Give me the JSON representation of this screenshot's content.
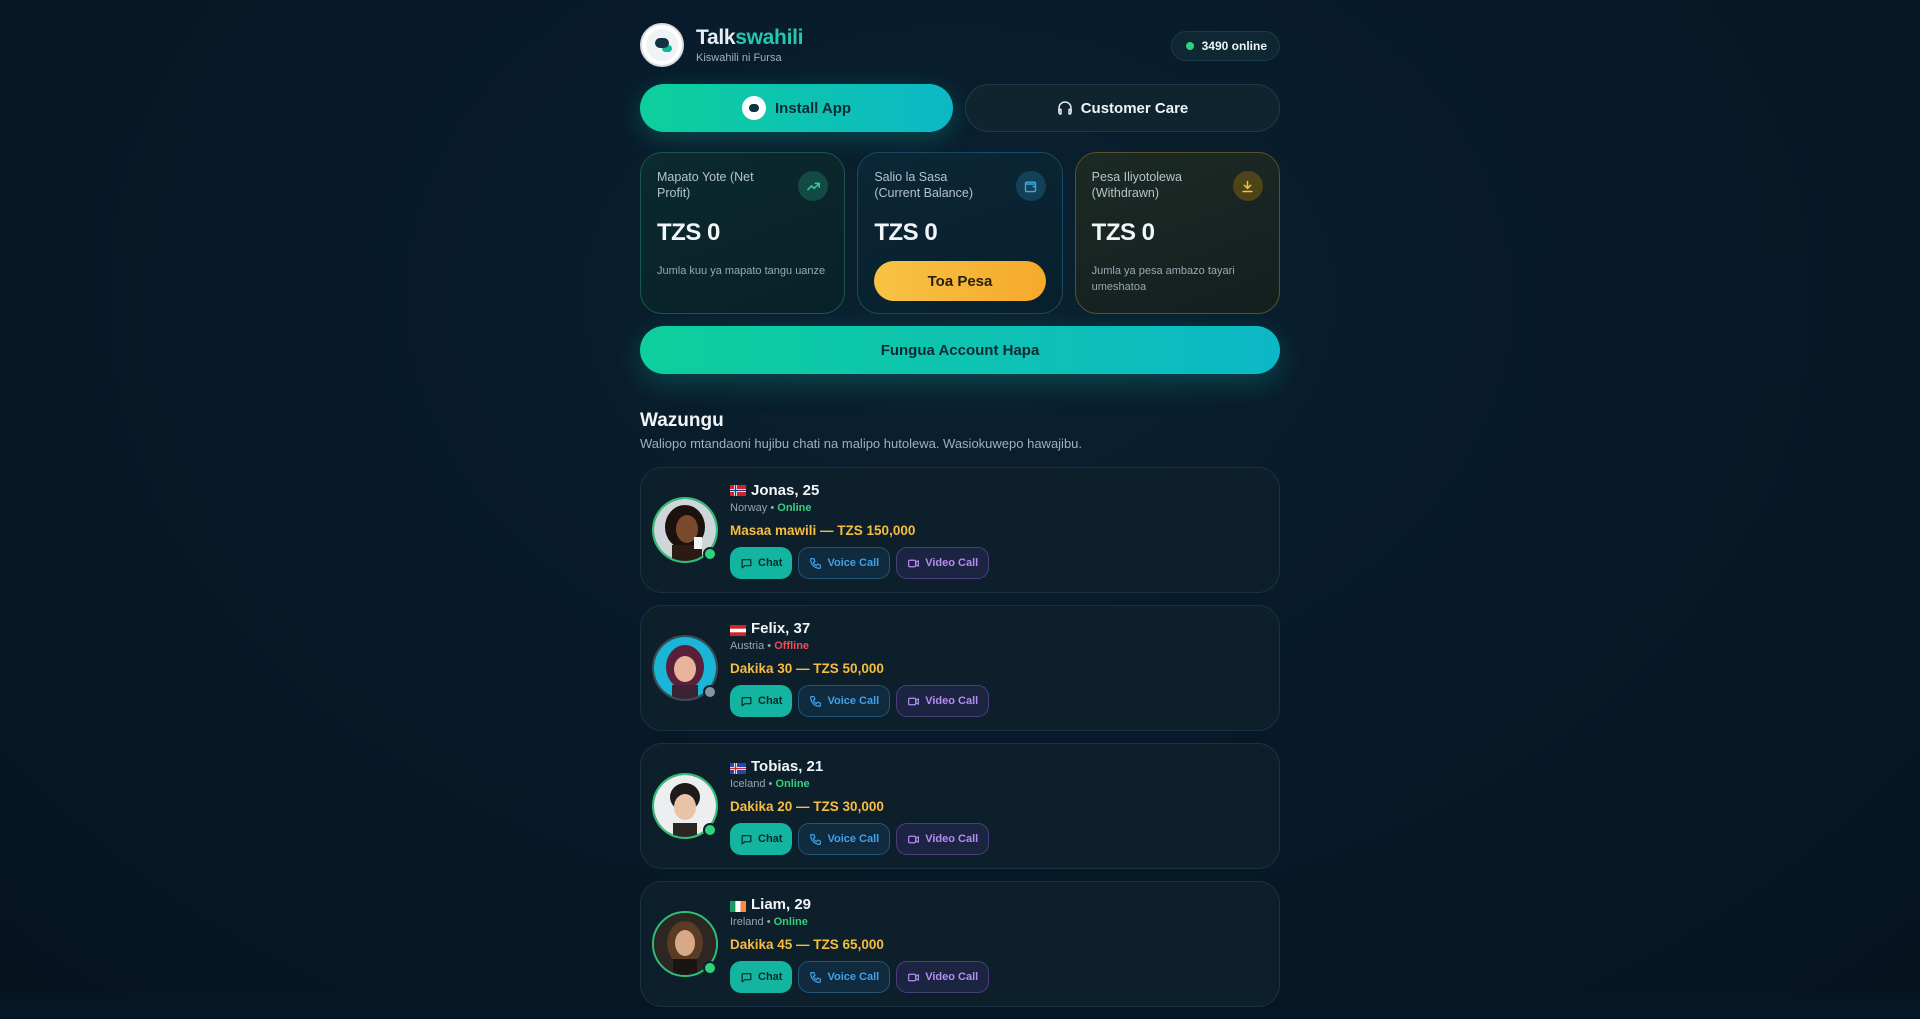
{
  "header": {
    "brand_talk": "Talk",
    "brand_swahili": "swahili",
    "tagline": "Kiswahili ni Fursa",
    "online_count": "3490 online"
  },
  "actions": {
    "install_label": "Install App",
    "care_label": "Customer Care"
  },
  "stats": {
    "profit": {
      "label": "Mapato Yote (Net Profit)",
      "value": "TZS 0",
      "note": "Jumla kuu ya mapato tangu uanze",
      "icon": "trend-up-icon"
    },
    "balance": {
      "label": "Salio la Sasa (Current Balance)",
      "value": "TZS 0",
      "button": "Toa Pesa",
      "icon": "wallet-icon"
    },
    "withdrawn": {
      "label": "Pesa Iliyotolewa (Withdrawn)",
      "value": "TZS 0",
      "note": "Jumla ya pesa ambazo tayari umeshatoa",
      "icon": "download-icon"
    }
  },
  "open_account_label": "Fungua Account Hapa",
  "section": {
    "title": "Wazungu",
    "subtitle": "Waliopo mtandaoni hujibu chati na malipo hutolewa. Wasiokuwepo hawajibu."
  },
  "buttons": {
    "chat": "Chat",
    "voice": "Voice Call",
    "video": "Video Call"
  },
  "profiles": [
    {
      "name": "Jonas, 25",
      "country": "Norway",
      "status": "Online",
      "price": "Masaa mawili — TZS 150,000"
    },
    {
      "name": "Felix, 37",
      "country": "Austria",
      "status": "Offline",
      "price": "Dakika 30 — TZS 50,000"
    },
    {
      "name": "Tobias, 21",
      "country": "Iceland",
      "status": "Online",
      "price": "Dakika 20 — TZS 30,000"
    },
    {
      "name": "Liam, 29",
      "country": "Ireland",
      "status": "Online",
      "price": "Dakika 45 — TZS 65,000"
    }
  ],
  "colors": {
    "accent_teal": "#0ecf9c",
    "gold": "#f6bd3e",
    "online_green": "#35d07e",
    "offline_red": "#f04d57"
  }
}
